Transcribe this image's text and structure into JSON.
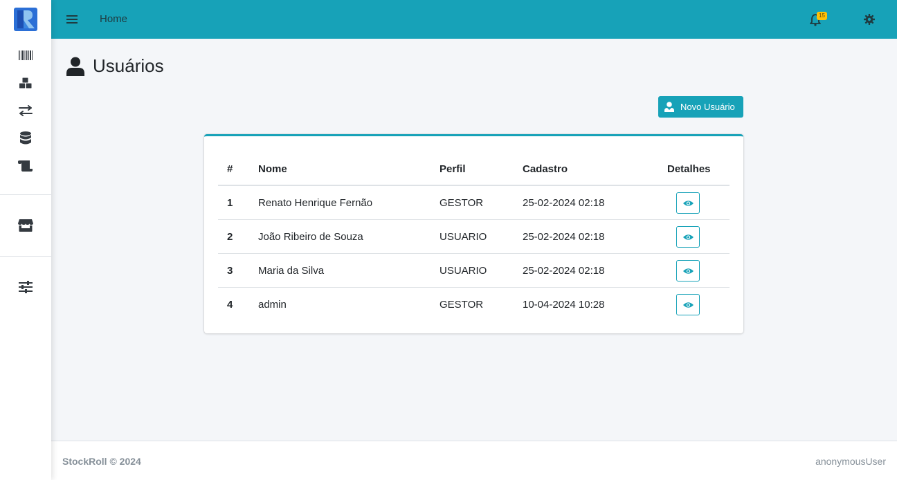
{
  "topbar": {
    "home_label": "Home",
    "notification_count": "15"
  },
  "page": {
    "title": "Usuários"
  },
  "actions": {
    "new_user_label": "Novo Usuário"
  },
  "table": {
    "headers": {
      "num": "#",
      "name": "Nome",
      "profile": "Perfil",
      "created": "Cadastro",
      "details": "Detalhes"
    },
    "rows": [
      {
        "num": "1",
        "name": "Renato Henrique Fernão",
        "profile": "GESTOR",
        "created": "25-02-2024 02:18"
      },
      {
        "num": "2",
        "name": "João Ribeiro de Souza",
        "profile": "USUARIO",
        "created": "25-02-2024 02:18"
      },
      {
        "num": "3",
        "name": "Maria da Silva",
        "profile": "USUARIO",
        "created": "25-02-2024 02:18"
      },
      {
        "num": "4",
        "name": "admin",
        "profile": "GESTOR",
        "created": "10-04-2024 10:28"
      }
    ]
  },
  "sidebar": {
    "icons": [
      "barcode-icon",
      "boxes-icon",
      "exchange-icon",
      "database-icon",
      "scroll-icon",
      "store-icon",
      "sliders-icon"
    ]
  },
  "footer": {
    "brand": "StockRoll © 2024",
    "user": "anonymousUser"
  },
  "colors": {
    "accent": "#17a2b8",
    "badge": "#ffc107",
    "background": "#f4f6f9"
  }
}
